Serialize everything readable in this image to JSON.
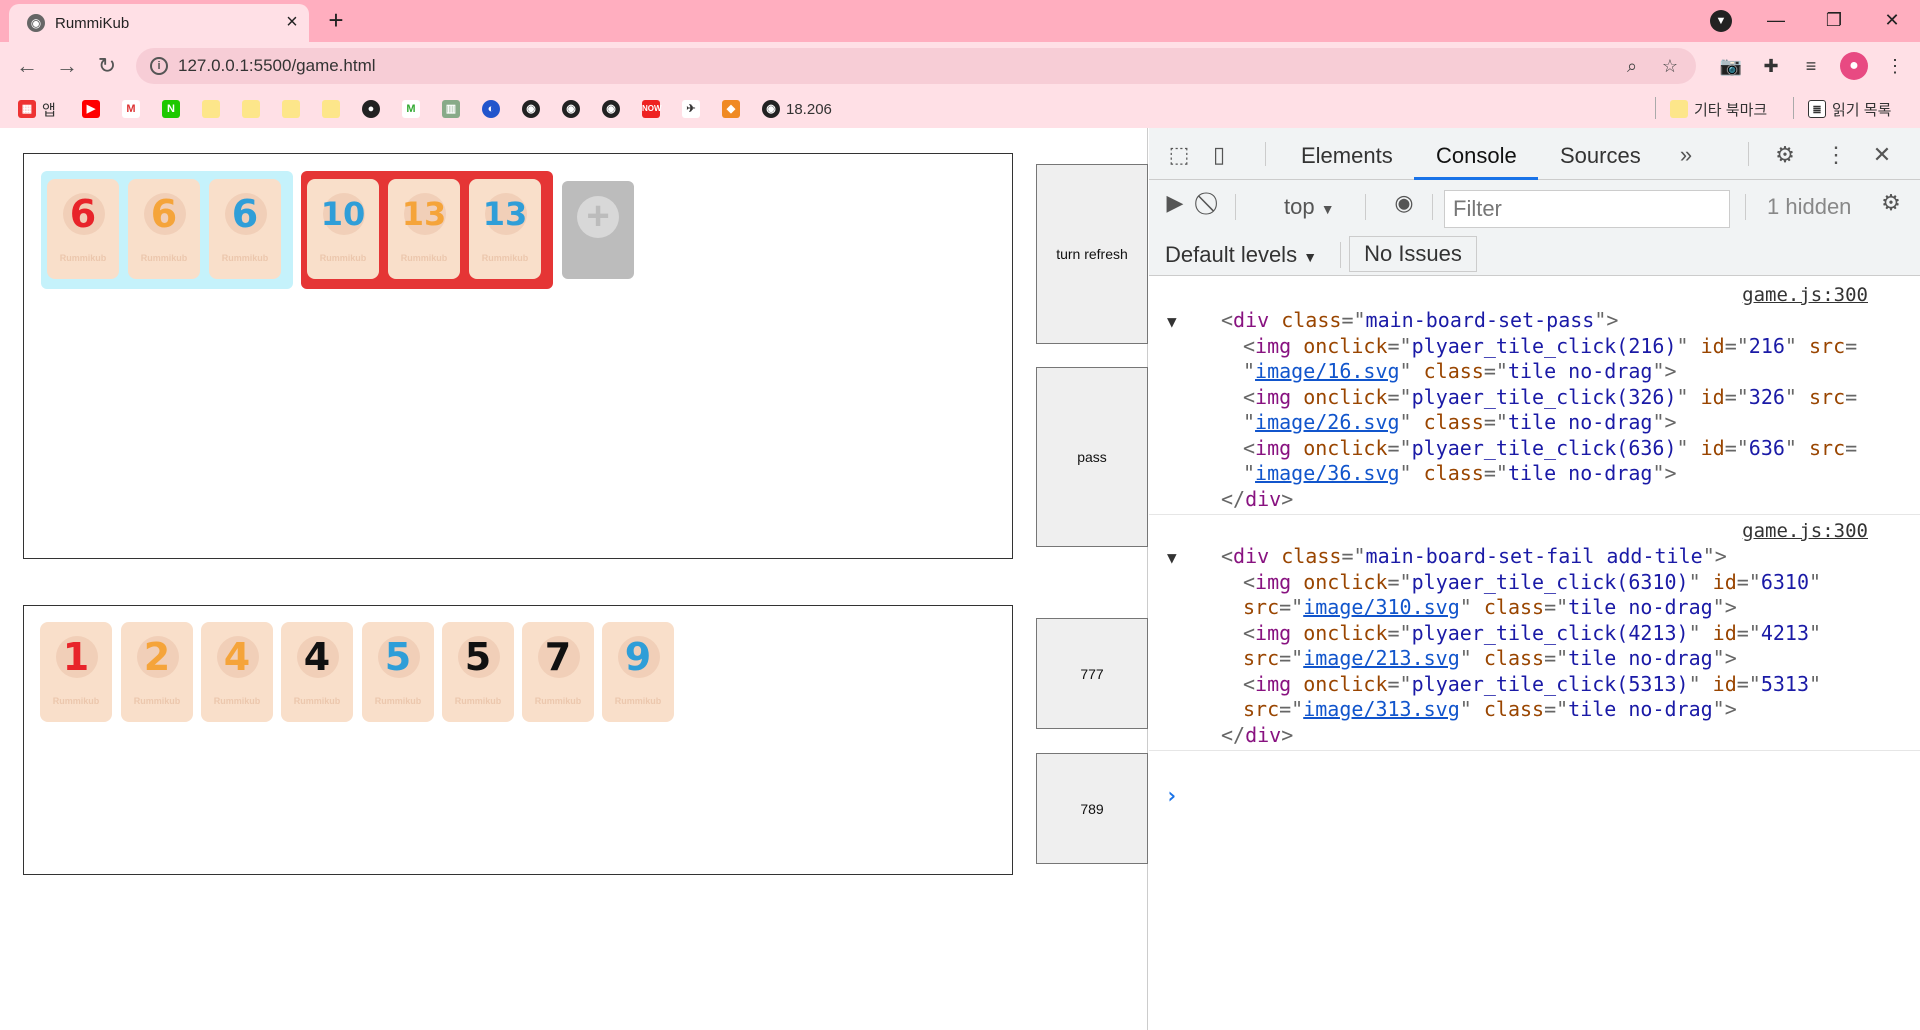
{
  "browser": {
    "tab_title": "RummiKub",
    "url": "127.0.0.1:5500/game.html",
    "bookmarks": [
      {
        "label": "앱",
        "icon": "apps-grid-icon"
      },
      {
        "label": "",
        "icon": "youtube-icon"
      },
      {
        "label": "",
        "icon": "gmail-icon"
      },
      {
        "label": "",
        "icon": "naver-icon"
      },
      {
        "label": "",
        "icon": "folder-icon"
      },
      {
        "label": "",
        "icon": "folder-icon"
      },
      {
        "label": "",
        "icon": "folder-icon"
      },
      {
        "label": "",
        "icon": "folder-icon"
      },
      {
        "label": "",
        "icon": "github-icon"
      },
      {
        "label": "",
        "icon": "m-icon"
      },
      {
        "label": "",
        "icon": "building-icon"
      },
      {
        "label": "",
        "icon": "circle-logo-icon"
      },
      {
        "label": "",
        "icon": "globe-icon"
      },
      {
        "label": "",
        "icon": "globe-icon"
      },
      {
        "label": "",
        "icon": "globe-icon"
      },
      {
        "label": "",
        "icon": "now-icon"
      },
      {
        "label": "",
        "icon": "steam-icon"
      },
      {
        "label": "",
        "icon": "cube-icon"
      },
      {
        "label": "18.206",
        "icon": "globe-icon"
      }
    ],
    "other_bookmarks": "기타 북마크",
    "reading_list": "읽기 목록"
  },
  "game": {
    "brand": "Rummikub",
    "board_sets": [
      {
        "status": "pass",
        "tiles": [
          {
            "n": "6",
            "color": "red"
          },
          {
            "n": "6",
            "color": "orange"
          },
          {
            "n": "6",
            "color": "blue"
          }
        ]
      },
      {
        "status": "fail",
        "tiles": [
          {
            "n": "10",
            "color": "blue"
          },
          {
            "n": "13",
            "color": "orange"
          },
          {
            "n": "13",
            "color": "blue"
          }
        ]
      }
    ],
    "hand": [
      {
        "n": "1",
        "color": "red"
      },
      {
        "n": "2",
        "color": "orange"
      },
      {
        "n": "4",
        "color": "orange"
      },
      {
        "n": "4",
        "color": "black"
      },
      {
        "n": "5",
        "color": "blue"
      },
      {
        "n": "5",
        "color": "black"
      },
      {
        "n": "7",
        "color": "black"
      },
      {
        "n": "9",
        "color": "blue"
      }
    ],
    "buttons": {
      "turn_refresh": "turn refresh",
      "pass": "pass",
      "sort_777": "777",
      "sort_789": "789"
    },
    "colors": {
      "red": "#e8242a",
      "orange": "#f5a43a",
      "blue": "#2f9ed8",
      "black": "#111111",
      "set_pass_bg": "#c5f2fb",
      "set_fail_bg": "#e53535",
      "tile_bg": "#f9dfca"
    }
  },
  "devtools": {
    "tabs": [
      "Elements",
      "Console",
      "Sources"
    ],
    "active_tab": "Console",
    "context": "top",
    "filter_placeholder": "Filter",
    "hidden_count": "1 hidden",
    "levels": "Default levels",
    "issues": "No Issues",
    "messages": [
      {
        "source": "game.js:300",
        "open_tag": "div",
        "class": "main-board-set-pass",
        "imgs": [
          {
            "onclick": "plyaer_tile_click(216)",
            "id": "216",
            "src": "image/16.svg",
            "class": "tile no-drag"
          },
          {
            "onclick": "plyaer_tile_click(326)",
            "id": "326",
            "src": "image/26.svg",
            "class": "tile no-drag"
          },
          {
            "onclick": "plyaer_tile_click(636)",
            "id": "636",
            "src": "image/36.svg",
            "class": "tile no-drag"
          }
        ]
      },
      {
        "source": "game.js:300",
        "open_tag": "div",
        "class": "main-board-set-fail add-tile",
        "imgs": [
          {
            "onclick": "plyaer_tile_click(6310)",
            "id": "6310",
            "src": "image/310.svg",
            "class": "tile no-drag"
          },
          {
            "onclick": "plyaer_tile_click(4213)",
            "id": "4213",
            "src": "image/213.svg",
            "class": "tile no-drag"
          },
          {
            "onclick": "plyaer_tile_click(5313)",
            "id": "5313",
            "src": "image/313.svg",
            "class": "tile no-drag"
          }
        ]
      }
    ]
  }
}
